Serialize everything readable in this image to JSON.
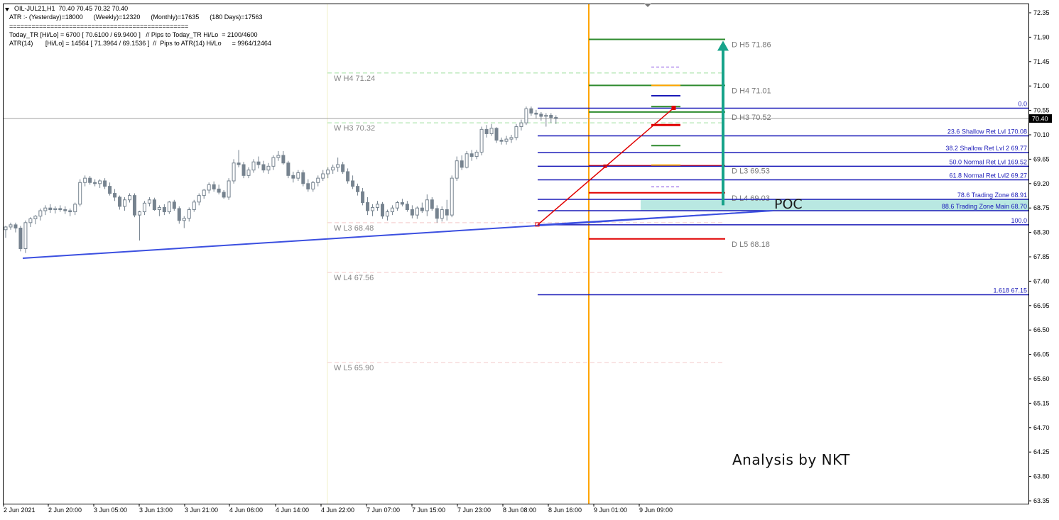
{
  "header": {
    "symbol_line": "OIL-JUL21,H1  70.40 70.45 70.32 70.40",
    "atr_line": "ATR :- (Yesterday)=18000      (Weekly)=12320      (Monthly)=17635      (180 Days)=17563",
    "separator": "================================================",
    "today_tr_line": "Today_TR [Hi/Lo] = 6700 [ 70.6100 / 69.9400 ]   // Pips to Today_TR Hi/Lo  = 2100/4600",
    "atr14_line": "ATR(14)       [Hi/Lo] = 14564 [ 71.3964 / 69.1536 ]  //  Pips to ATR(14) Hi/Lo      = 9964/12464"
  },
  "watermark": "Analysis by NKT",
  "poc_label": "POC",
  "colors": {
    "candle": "#76838f",
    "daily_line": "#2e8b2e",
    "weekly_line": "#9fe09f",
    "fib": "#1a1ab8",
    "red": "#e00000",
    "orange": "#ffa500",
    "teal": "#17a38a",
    "poc_band": "#b9e8e2",
    "trend": "#3b4fe0",
    "purple": "#7a3ee0"
  },
  "chart_data": {
    "type": "candlestick",
    "instrument": "OIL-JUL21",
    "timeframe": "H1",
    "current_price": "70.40",
    "y_ticks": [
      "72.35",
      "71.90",
      "71.45",
      "71.00",
      "70.55",
      "70.10",
      "69.65",
      "69.20",
      "68.75",
      "68.30",
      "67.85",
      "67.40",
      "66.95",
      "66.50",
      "66.05",
      "65.60",
      "65.15",
      "64.70",
      "64.25",
      "63.80",
      "63.35"
    ],
    "ylim": [
      63.35,
      72.35
    ],
    "x_ticks": [
      "2 Jun 2021",
      "2 Jun 20:00",
      "3 Jun 05:00",
      "3 Jun 13:00",
      "3 Jun 21:00",
      "4 Jun 06:00",
      "4 Jun 14:00",
      "4 Jun 22:00",
      "7 Jun 07:00",
      "7 Jun 15:00",
      "7 Jun 23:00",
      "8 Jun 08:00",
      "8 Jun 16:00",
      "9 Jun 01:00",
      "9 Jun 09:00"
    ],
    "weekly_levels": [
      {
        "label": "W  H4 71.24",
        "value": 71.24
      },
      {
        "label": "W  H3 70.32",
        "value": 70.32
      },
      {
        "label": "W  L3 68.48",
        "value": 68.48
      },
      {
        "label": "W  L4 67.56",
        "value": 67.56
      },
      {
        "label": "W  L5 65.90",
        "value": 65.9
      }
    ],
    "daily_levels": [
      {
        "label": "D  H5 71.86",
        "value": 71.86
      },
      {
        "label": "D  H4 71.01",
        "value": 71.01
      },
      {
        "label": "D  H3 70.52",
        "value": 70.52
      },
      {
        "label": "D  L3 69.53",
        "value": 69.53
      },
      {
        "label": "D  L4 69.03",
        "value": 69.03
      },
      {
        "label": "D  L5 68.18",
        "value": 68.18
      }
    ],
    "fib_levels": [
      {
        "label": "0.0",
        "value": 70.59
      },
      {
        "label": "23.6 Shallow Ret Lvl 170.08",
        "value": 70.08
      },
      {
        "label": "38.2 Shallow Ret Lvl 2 69.77",
        "value": 69.77
      },
      {
        "label": "50.0 Normal Ret Lvl 169.52",
        "value": 69.52
      },
      {
        "label": "61.8 Normal Ret Lvl2 69.27",
        "value": 69.27
      },
      {
        "label": "78.6 Trading Zone 68.91",
        "value": 68.91
      },
      {
        "label": "88.6 Trading Zone Main 68.70",
        "value": 68.7
      },
      {
        "label": "100.0",
        "value": 68.44
      },
      {
        "label": "1.618 67.15",
        "value": 67.15
      }
    ],
    "candles": [
      [
        68.35,
        68.42,
        68.2,
        68.4
      ],
      [
        68.4,
        68.48,
        68.35,
        68.44
      ],
      [
        68.44,
        68.48,
        68.3,
        68.38
      ],
      [
        68.38,
        68.42,
        67.95,
        68.0
      ],
      [
        68.0,
        68.52,
        67.92,
        68.48
      ],
      [
        68.48,
        68.58,
        68.4,
        68.55
      ],
      [
        68.55,
        68.62,
        68.45,
        68.6
      ],
      [
        68.6,
        68.74,
        68.52,
        68.7
      ],
      [
        68.7,
        68.8,
        68.62,
        68.75
      ],
      [
        68.75,
        68.82,
        68.66,
        68.72
      ],
      [
        68.72,
        68.78,
        68.65,
        68.74
      ],
      [
        68.74,
        68.8,
        68.68,
        68.72
      ],
      [
        68.72,
        68.78,
        68.64,
        68.7
      ],
      [
        68.7,
        68.74,
        68.6,
        68.68
      ],
      [
        68.68,
        68.85,
        68.62,
        68.82
      ],
      [
        68.82,
        69.28,
        68.78,
        69.22
      ],
      [
        69.22,
        69.35,
        69.15,
        69.3
      ],
      [
        69.3,
        69.34,
        69.18,
        69.22
      ],
      [
        69.22,
        69.28,
        69.15,
        69.2
      ],
      [
        69.2,
        69.28,
        69.12,
        69.25
      ],
      [
        69.25,
        69.3,
        69.1,
        69.15
      ],
      [
        69.15,
        69.22,
        68.98,
        69.02
      ],
      [
        69.02,
        69.1,
        68.88,
        68.95
      ],
      [
        68.95,
        68.98,
        68.72,
        68.78
      ],
      [
        68.78,
        68.95,
        68.7,
        68.9
      ],
      [
        68.9,
        69.02,
        68.85,
        68.98
      ],
      [
        68.98,
        69.02,
        68.58,
        68.62
      ],
      [
        68.62,
        68.7,
        68.15,
        68.68
      ],
      [
        68.68,
        68.88,
        68.62,
        68.84
      ],
      [
        68.84,
        68.95,
        68.78,
        68.9
      ],
      [
        68.9,
        68.94,
        68.7,
        68.72
      ],
      [
        68.72,
        68.8,
        68.6,
        68.76
      ],
      [
        68.76,
        68.82,
        68.62,
        68.68
      ],
      [
        68.68,
        68.88,
        68.64,
        68.86
      ],
      [
        68.86,
        68.9,
        68.7,
        68.74
      ],
      [
        68.74,
        68.78,
        68.46,
        68.52
      ],
      [
        68.52,
        68.6,
        68.38,
        68.56
      ],
      [
        68.56,
        68.76,
        68.5,
        68.72
      ],
      [
        68.72,
        68.9,
        68.68,
        68.86
      ],
      [
        68.86,
        69.02,
        68.8,
        68.98
      ],
      [
        68.98,
        69.1,
        68.92,
        69.08
      ],
      [
        69.08,
        69.22,
        69.02,
        69.18
      ],
      [
        69.18,
        69.24,
        69.05,
        69.1
      ],
      [
        69.1,
        69.18,
        69.0,
        69.04
      ],
      [
        69.04,
        69.08,
        68.92,
        68.95
      ],
      [
        68.95,
        69.3,
        68.9,
        69.25
      ],
      [
        69.25,
        69.65,
        69.2,
        69.58
      ],
      [
        69.58,
        69.82,
        69.5,
        69.55
      ],
      [
        69.55,
        69.6,
        69.3,
        69.35
      ],
      [
        69.35,
        69.5,
        69.3,
        69.45
      ],
      [
        69.45,
        69.65,
        69.4,
        69.6
      ],
      [
        69.6,
        69.7,
        69.48,
        69.55
      ],
      [
        69.55,
        69.62,
        69.4,
        69.45
      ],
      [
        69.45,
        69.58,
        69.38,
        69.52
      ],
      [
        69.52,
        69.72,
        69.45,
        69.68
      ],
      [
        69.68,
        69.8,
        69.62,
        69.72
      ],
      [
        69.72,
        69.8,
        69.55,
        69.58
      ],
      [
        69.58,
        69.62,
        69.3,
        69.35
      ],
      [
        69.35,
        69.42,
        69.22,
        69.3
      ],
      [
        69.3,
        69.45,
        69.25,
        69.4
      ],
      [
        69.4,
        69.45,
        69.15,
        69.2
      ],
      [
        69.2,
        69.28,
        69.05,
        69.1
      ],
      [
        69.1,
        69.25,
        69.05,
        69.22
      ],
      [
        69.22,
        69.35,
        69.15,
        69.3
      ],
      [
        69.3,
        69.45,
        69.25,
        69.38
      ],
      [
        69.38,
        69.5,
        69.3,
        69.45
      ],
      [
        69.45,
        69.55,
        69.38,
        69.5
      ],
      [
        69.5,
        69.68,
        69.42,
        69.55
      ],
      [
        69.55,
        69.6,
        69.38,
        69.42
      ],
      [
        69.42,
        69.48,
        69.2,
        69.25
      ],
      [
        69.25,
        69.35,
        69.1,
        69.15
      ],
      [
        69.15,
        69.2,
        68.98,
        69.05
      ],
      [
        69.05,
        69.12,
        68.8,
        68.85
      ],
      [
        68.85,
        68.95,
        68.62,
        68.7
      ],
      [
        68.7,
        68.82,
        68.6,
        68.76
      ],
      [
        68.76,
        68.88,
        68.7,
        68.82
      ],
      [
        68.82,
        68.86,
        68.55,
        68.6
      ],
      [
        68.6,
        68.72,
        68.52,
        68.68
      ],
      [
        68.68,
        68.8,
        68.62,
        68.75
      ],
      [
        68.75,
        68.88,
        68.7,
        68.85
      ],
      [
        68.85,
        68.92,
        68.78,
        68.82
      ],
      [
        68.82,
        68.88,
        68.68,
        68.72
      ],
      [
        68.72,
        68.8,
        68.56,
        68.62
      ],
      [
        68.62,
        68.78,
        68.55,
        68.75
      ],
      [
        68.75,
        68.85,
        68.66,
        68.7
      ],
      [
        68.7,
        69.0,
        68.6,
        68.9
      ],
      [
        68.9,
        68.95,
        68.7,
        68.74
      ],
      [
        68.74,
        68.8,
        68.48,
        68.56
      ],
      [
        68.56,
        68.78,
        68.5,
        68.72
      ],
      [
        68.72,
        68.9,
        68.52,
        68.62
      ],
      [
        68.62,
        69.35,
        68.58,
        69.3
      ],
      [
        69.3,
        69.7,
        69.25,
        69.62
      ],
      [
        69.62,
        69.72,
        69.45,
        69.5
      ],
      [
        69.5,
        69.8,
        69.48,
        69.75
      ],
      [
        69.75,
        69.82,
        69.62,
        69.7
      ],
      [
        69.7,
        69.82,
        69.65,
        69.78
      ],
      [
        69.78,
        70.25,
        69.72,
        70.2
      ],
      [
        70.2,
        70.28,
        70.05,
        70.12
      ],
      [
        70.12,
        70.3,
        70.08,
        70.22
      ],
      [
        70.22,
        70.24,
        69.95,
        70.0
      ],
      [
        70.0,
        70.05,
        69.92,
        69.98
      ],
      [
        69.98,
        70.08,
        69.92,
        70.02
      ],
      [
        70.02,
        70.1,
        69.95,
        70.05
      ],
      [
        70.05,
        70.3,
        70.0,
        70.25
      ],
      [
        70.25,
        70.38,
        70.18,
        70.32
      ],
      [
        70.32,
        70.62,
        70.28,
        70.58
      ],
      [
        70.58,
        70.62,
        70.45,
        70.5
      ],
      [
        70.5,
        70.56,
        70.4,
        70.48
      ],
      [
        70.48,
        70.52,
        70.36,
        70.44
      ],
      [
        70.44,
        70.5,
        70.25,
        70.46
      ],
      [
        70.46,
        70.5,
        70.32,
        70.42
      ],
      [
        70.42,
        70.46,
        70.3,
        70.4
      ]
    ]
  }
}
